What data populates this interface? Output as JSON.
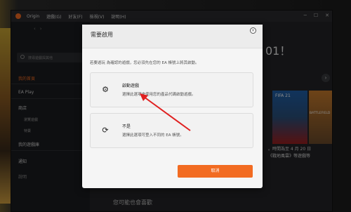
{
  "titlebar": {
    "app_name": "Origin",
    "menu": [
      "遊戲(G)",
      "好友(F)",
      "檢視(V)",
      "說明(H)"
    ],
    "window_controls": [
      "minimize-icon",
      "maximize-icon",
      "close-icon"
    ]
  },
  "sidebar": {
    "search_placeholder": "搜尋遊戲與其他",
    "items": [
      {
        "label": "我的首頁"
      },
      {
        "label": "EA Play"
      },
      {
        "label": "商店"
      },
      {
        "label": "瀏覽遊戲"
      },
      {
        "label": "特賣"
      },
      {
        "label": "我的遊戲庫"
      },
      {
        "label": "通知"
      },
      {
        "label": "說明"
      }
    ]
  },
  "content": {
    "banner_title": "01！",
    "fifa_label": "FIFA 21",
    "bf_label": "BATTLEFIELD",
    "promo_text_1": "。時間為至 4 月 20 日",
    "promo_text_2": "《戰地風雲》等遊戲等",
    "recommend_title": "您可能也會喜歡"
  },
  "modal": {
    "title": "需要啟用",
    "description": "若要遊玩 為確認的遊戲，您必須先在您的 EA 帳號上將其啟動。",
    "option1": {
      "icon": "gear-icon",
      "title": "啟動遊戲",
      "desc": "選擇此選項來使用您的產品代碼啟動遊戲。"
    },
    "option2": {
      "icon": "refresh-icon",
      "title": "不是",
      "desc": "選擇此選項可登入不同的 EA 帳號。"
    },
    "cancel_label": "取消"
  },
  "colors": {
    "accent": "#f26b21",
    "annotation": "#e02020"
  }
}
